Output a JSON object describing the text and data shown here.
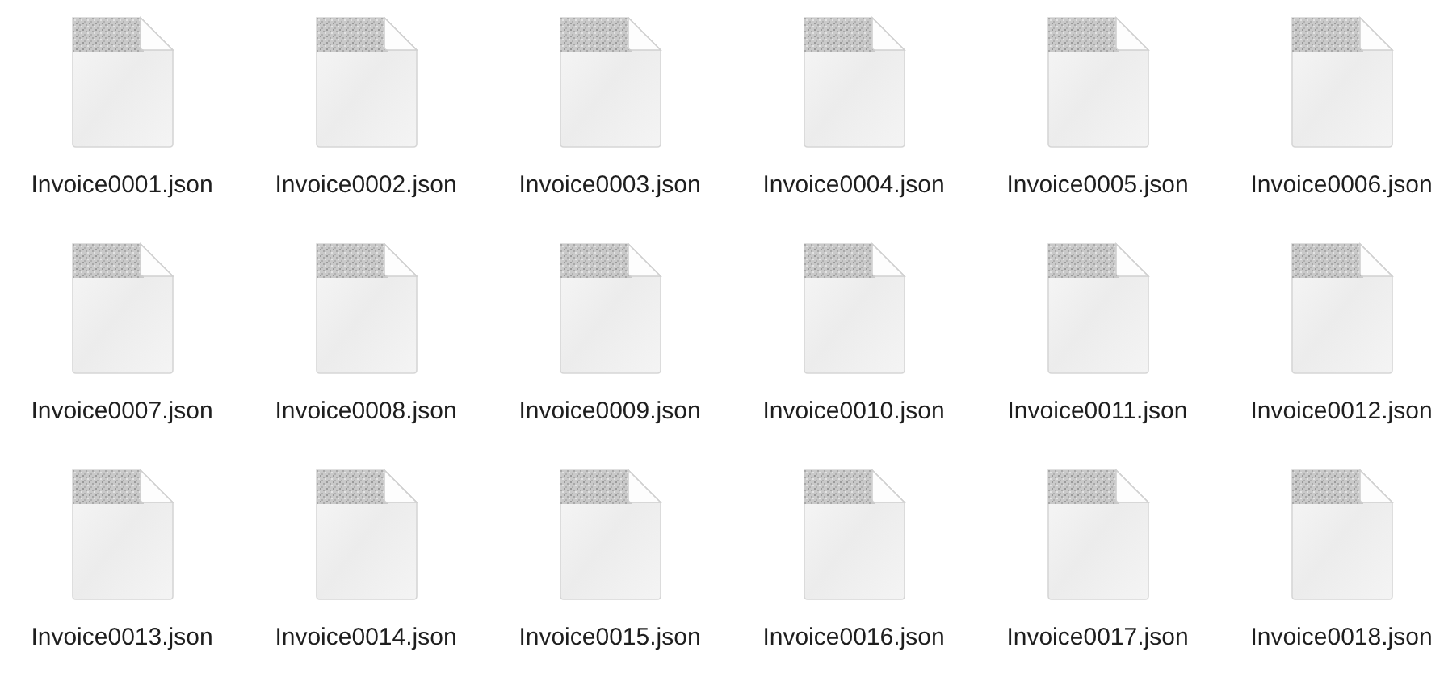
{
  "files": [
    {
      "name": "Invoice0001.json"
    },
    {
      "name": "Invoice0002.json"
    },
    {
      "name": "Invoice0003.json"
    },
    {
      "name": "Invoice0004.json"
    },
    {
      "name": "Invoice0005.json"
    },
    {
      "name": "Invoice0006.json"
    },
    {
      "name": "Invoice0007.json"
    },
    {
      "name": "Invoice0008.json"
    },
    {
      "name": "Invoice0009.json"
    },
    {
      "name": "Invoice0010.json"
    },
    {
      "name": "Invoice0011.json"
    },
    {
      "name": "Invoice0012.json"
    },
    {
      "name": "Invoice0013.json"
    },
    {
      "name": "Invoice0014.json"
    },
    {
      "name": "Invoice0015.json"
    },
    {
      "name": "Invoice0016.json"
    },
    {
      "name": "Invoice0017.json"
    },
    {
      "name": "Invoice0018.json"
    }
  ]
}
